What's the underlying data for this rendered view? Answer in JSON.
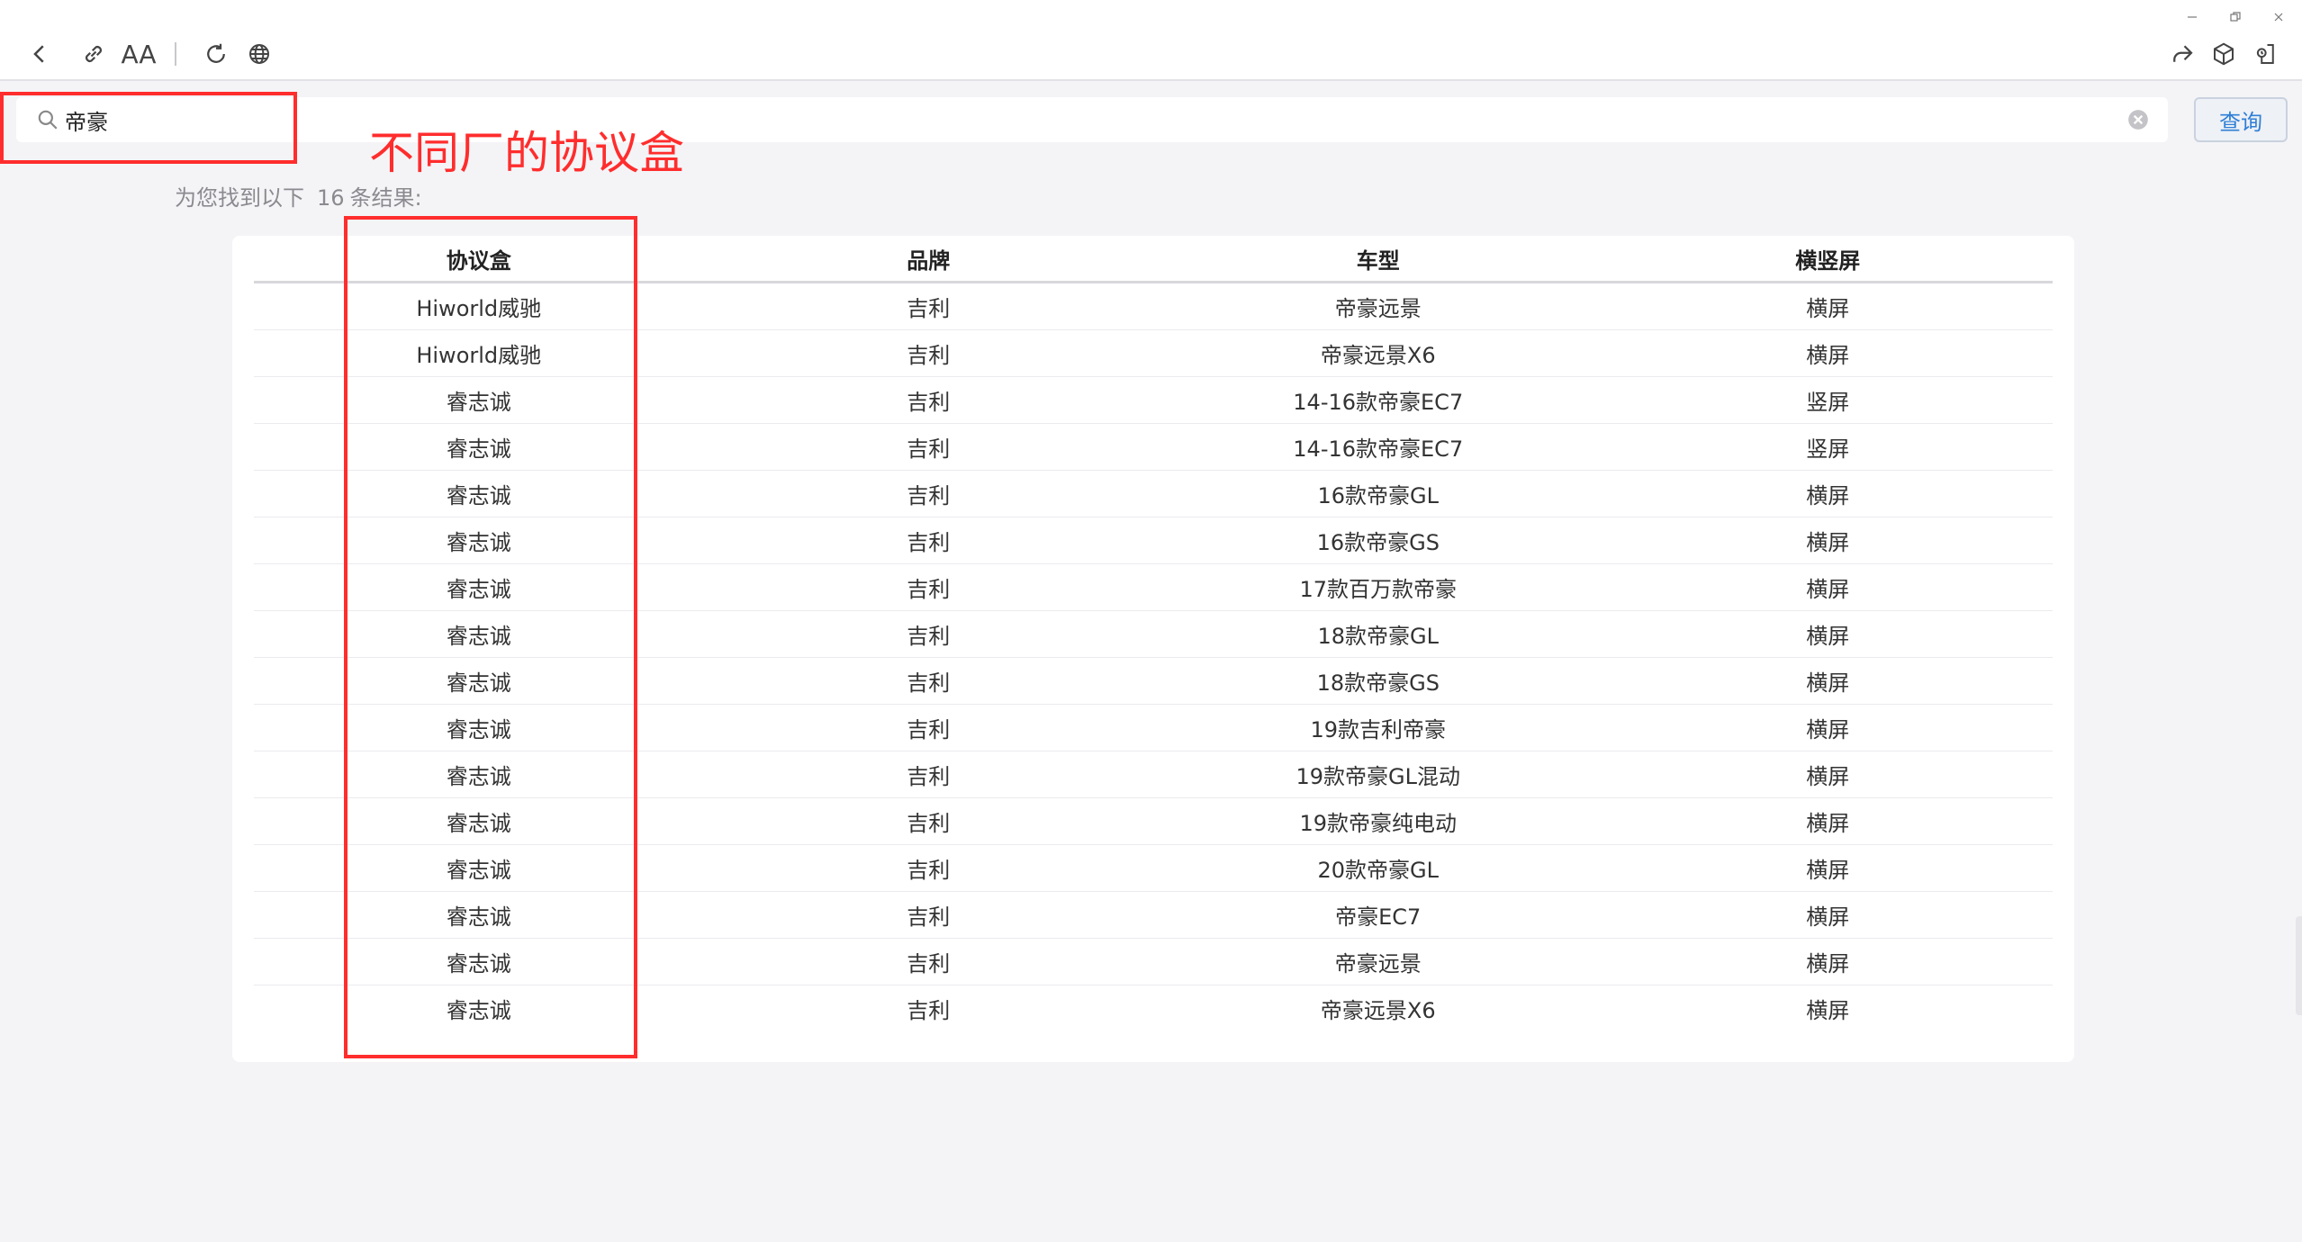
{
  "toolbar": {
    "back_icon": "chevron-left-icon",
    "link_icon": "link-icon",
    "font_label": "AA",
    "refresh_icon": "refresh-icon",
    "globe_icon": "globe-icon",
    "share_icon": "share-icon",
    "cube_icon": "cube-icon",
    "exit_icon": "exit-icon"
  },
  "search": {
    "value": "帝豪",
    "button_label": "查询"
  },
  "annotation": {
    "text": "不同厂的协议盒",
    "color": "#ff2d2d"
  },
  "results": {
    "prefix": "为您找到以下",
    "count": "16",
    "suffix": "条结果:"
  },
  "table": {
    "headers": [
      "协议盒",
      "品牌",
      "车型",
      "横竖屏"
    ],
    "rows": [
      [
        "Hiworld威驰",
        "吉利",
        "帝豪远景",
        "横屏"
      ],
      [
        "Hiworld威驰",
        "吉利",
        "帝豪远景X6",
        "横屏"
      ],
      [
        "睿志诚",
        "吉利",
        "14-16款帝豪EC7",
        "竖屏"
      ],
      [
        "睿志诚",
        "吉利",
        "14-16款帝豪EC7",
        "竖屏"
      ],
      [
        "睿志诚",
        "吉利",
        "16款帝豪GL",
        "横屏"
      ],
      [
        "睿志诚",
        "吉利",
        "16款帝豪GS",
        "横屏"
      ],
      [
        "睿志诚",
        "吉利",
        "17款百万款帝豪",
        "横屏"
      ],
      [
        "睿志诚",
        "吉利",
        "18款帝豪GL",
        "横屏"
      ],
      [
        "睿志诚",
        "吉利",
        "18款帝豪GS",
        "横屏"
      ],
      [
        "睿志诚",
        "吉利",
        "19款吉利帝豪",
        "横屏"
      ],
      [
        "睿志诚",
        "吉利",
        "19款帝豪GL混动",
        "横屏"
      ],
      [
        "睿志诚",
        "吉利",
        "19款帝豪纯电动",
        "横屏"
      ],
      [
        "睿志诚",
        "吉利",
        "20款帝豪GL",
        "横屏"
      ],
      [
        "睿志诚",
        "吉利",
        "帝豪EC7",
        "横屏"
      ],
      [
        "睿志诚",
        "吉利",
        "帝豪远景",
        "横屏"
      ],
      [
        "睿志诚",
        "吉利",
        "帝豪远景X6",
        "横屏"
      ]
    ]
  },
  "colors": {
    "accent": "#2f7fd6",
    "annotation_red": "#ff2d2d",
    "background": "#f4f4f7"
  }
}
